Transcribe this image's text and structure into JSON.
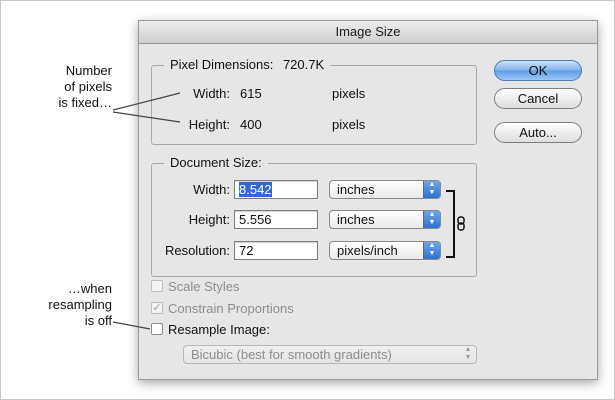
{
  "annotations": {
    "fixed_lines": [
      "Number",
      "of pixels",
      "is fixed…"
    ],
    "resample_lines": [
      "…when",
      "resampling",
      "is off"
    ]
  },
  "dialog": {
    "title": "Image Size",
    "pixel_dimensions": {
      "title": "Pixel Dimensions:",
      "size": "720.7K",
      "width_label": "Width:",
      "width_value": "615",
      "width_unit": "pixels",
      "height_label": "Height:",
      "height_value": "400",
      "height_unit": "pixels"
    },
    "document_size": {
      "title": "Document Size:",
      "width_label": "Width:",
      "width_value": "8.542",
      "width_unit": "inches",
      "height_label": "Height:",
      "height_value": "5.556",
      "height_unit": "inches",
      "resolution_label": "Resolution:",
      "resolution_value": "72",
      "resolution_unit": "pixels/inch"
    },
    "checkboxes": {
      "scale_styles": "Scale Styles",
      "constrain_proportions": "Constrain Proportions",
      "resample_image": "Resample Image:"
    },
    "resample_method": "Bicubic (best for smooth gradients)",
    "buttons": {
      "ok": "OK",
      "cancel": "Cancel",
      "auto": "Auto..."
    }
  }
}
